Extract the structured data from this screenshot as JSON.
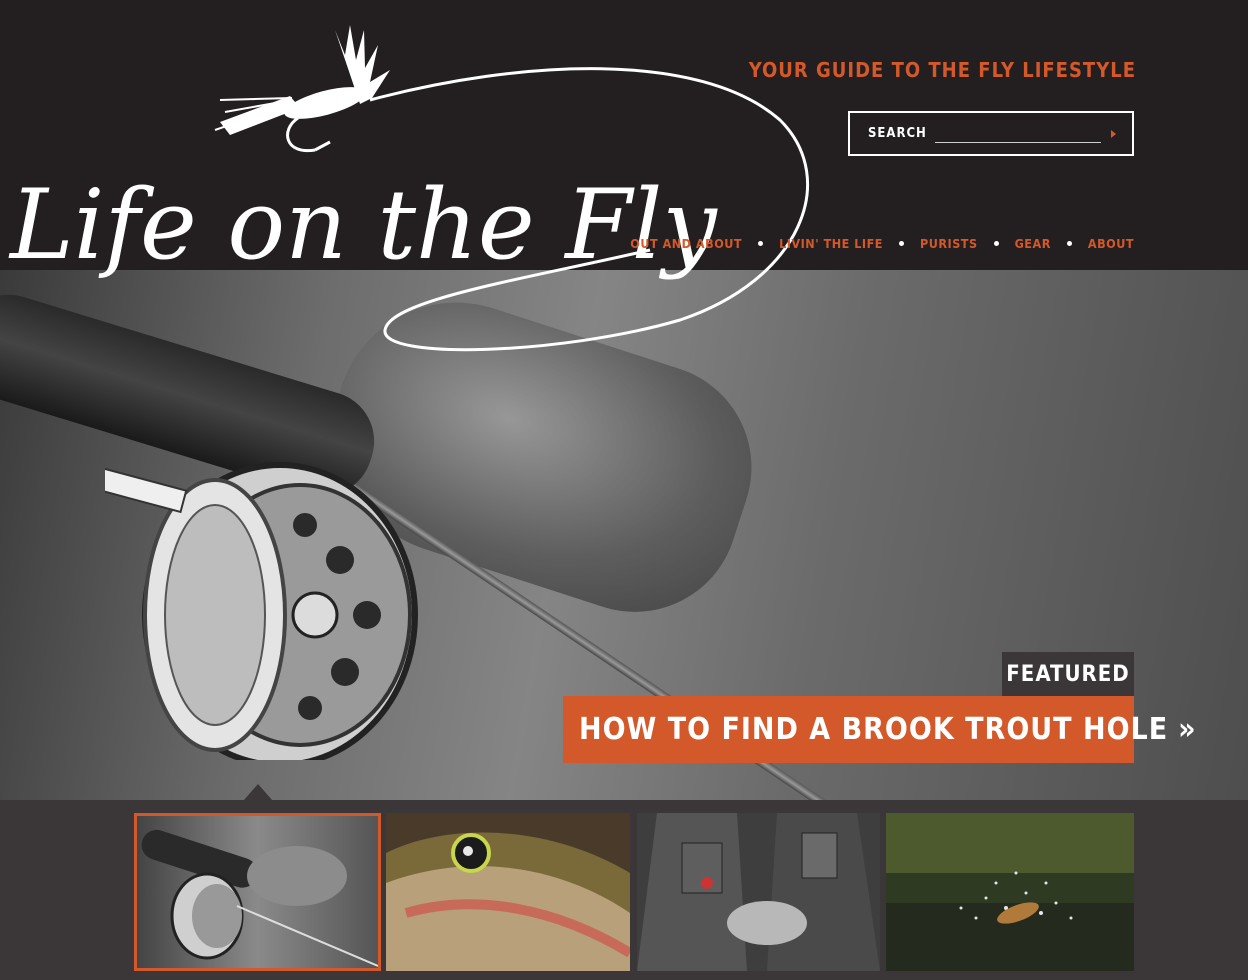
{
  "brand": {
    "logo_text": "Life on the Fly",
    "tagline": "YOUR GUIDE TO THE FLY LIFESTYLE"
  },
  "search": {
    "label": "SEARCH",
    "value": "",
    "submit_icon": "play-arrow-icon"
  },
  "nav": {
    "items": [
      {
        "label": "OUT AND ABOUT"
      },
      {
        "label": "LIVIN' THE LIFE"
      },
      {
        "label": "PURISTS"
      },
      {
        "label": "GEAR"
      },
      {
        "label": "ABOUT"
      }
    ]
  },
  "featured": {
    "tag": "FEATURED",
    "title": "HOW TO FIND A BROOK TROUT HOLE",
    "chevron": "»"
  },
  "thumbnails": [
    {
      "subject": "fly rod and reel in hand",
      "active": true
    },
    {
      "subject": "trout close-up",
      "active": false
    },
    {
      "subject": "angler tying a fly",
      "active": false
    },
    {
      "subject": "fish jumping from water",
      "active": false
    }
  ],
  "colors": {
    "background": "#231f20",
    "accent": "#d4592a",
    "thumb_bar": "#3b3637",
    "text_light": "#ffffff"
  }
}
